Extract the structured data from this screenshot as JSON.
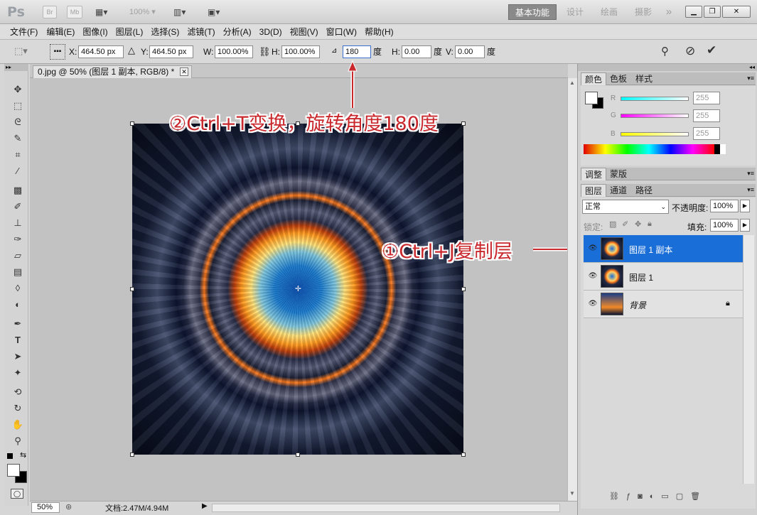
{
  "app": {
    "logo": "Ps",
    "bridge_btn": "Br",
    "minibridge_btn": "Mb",
    "zoom_level": "100%",
    "workspaces": [
      "基本功能",
      "设计",
      "绘画",
      "摄影",
      "»"
    ],
    "window_controls": [
      "minimize-icon",
      "restore-icon",
      "close-icon"
    ]
  },
  "menu": [
    "文件(F)",
    "编辑(E)",
    "图像(I)",
    "图层(L)",
    "选择(S)",
    "滤镜(T)",
    "分析(A)",
    "3D(D)",
    "视图(V)",
    "窗口(W)",
    "帮助(H)"
  ],
  "options": {
    "x_label": "X:",
    "x_value": "464.50 px",
    "y_label": "Y:",
    "y_value": "464.50 px",
    "w_label": "W:",
    "w_value": "100.00%",
    "h_label": "H:",
    "h_value": "100.00%",
    "angle_value": "180",
    "angle_unit": "度",
    "hskew_label": "H:",
    "hskew_value": "0.00",
    "hskew_unit": "度",
    "vskew_label": "V:",
    "vskew_value": "0.00",
    "vskew_unit": "度"
  },
  "document": {
    "tab_title": "0.jpg @ 50% (图层 1 副本, RGB/8) *",
    "status_zoom": "50%",
    "status_doc": "文档:2.47M/4.94M"
  },
  "annotations": {
    "step2": "②Ctrl+T变换，旋转角度180度",
    "step1": "①Ctrl+J复制层"
  },
  "panels": {
    "color_tabs": [
      "颜色",
      "色板",
      "样式"
    ],
    "color": {
      "r_label": "R",
      "r_value": "255",
      "g_label": "G",
      "g_value": "255",
      "b_label": "B",
      "b_value": "255"
    },
    "adjust_tabs": [
      "调整",
      "蒙版"
    ],
    "layers_tabs": [
      "图层",
      "通道",
      "路径"
    ],
    "blend_mode": "正常",
    "opacity_label": "不透明度:",
    "opacity_value": "100%",
    "lock_label": "锁定:",
    "fill_label": "填充:",
    "fill_value": "100%",
    "layers": [
      {
        "name": "图层 1 副本",
        "selected": true
      },
      {
        "name": "图层 1",
        "selected": false
      },
      {
        "name": "背景",
        "selected": false,
        "locked": true
      }
    ]
  },
  "colors": {
    "selection": "#1a6ed8",
    "annotation": "#c9282d"
  }
}
